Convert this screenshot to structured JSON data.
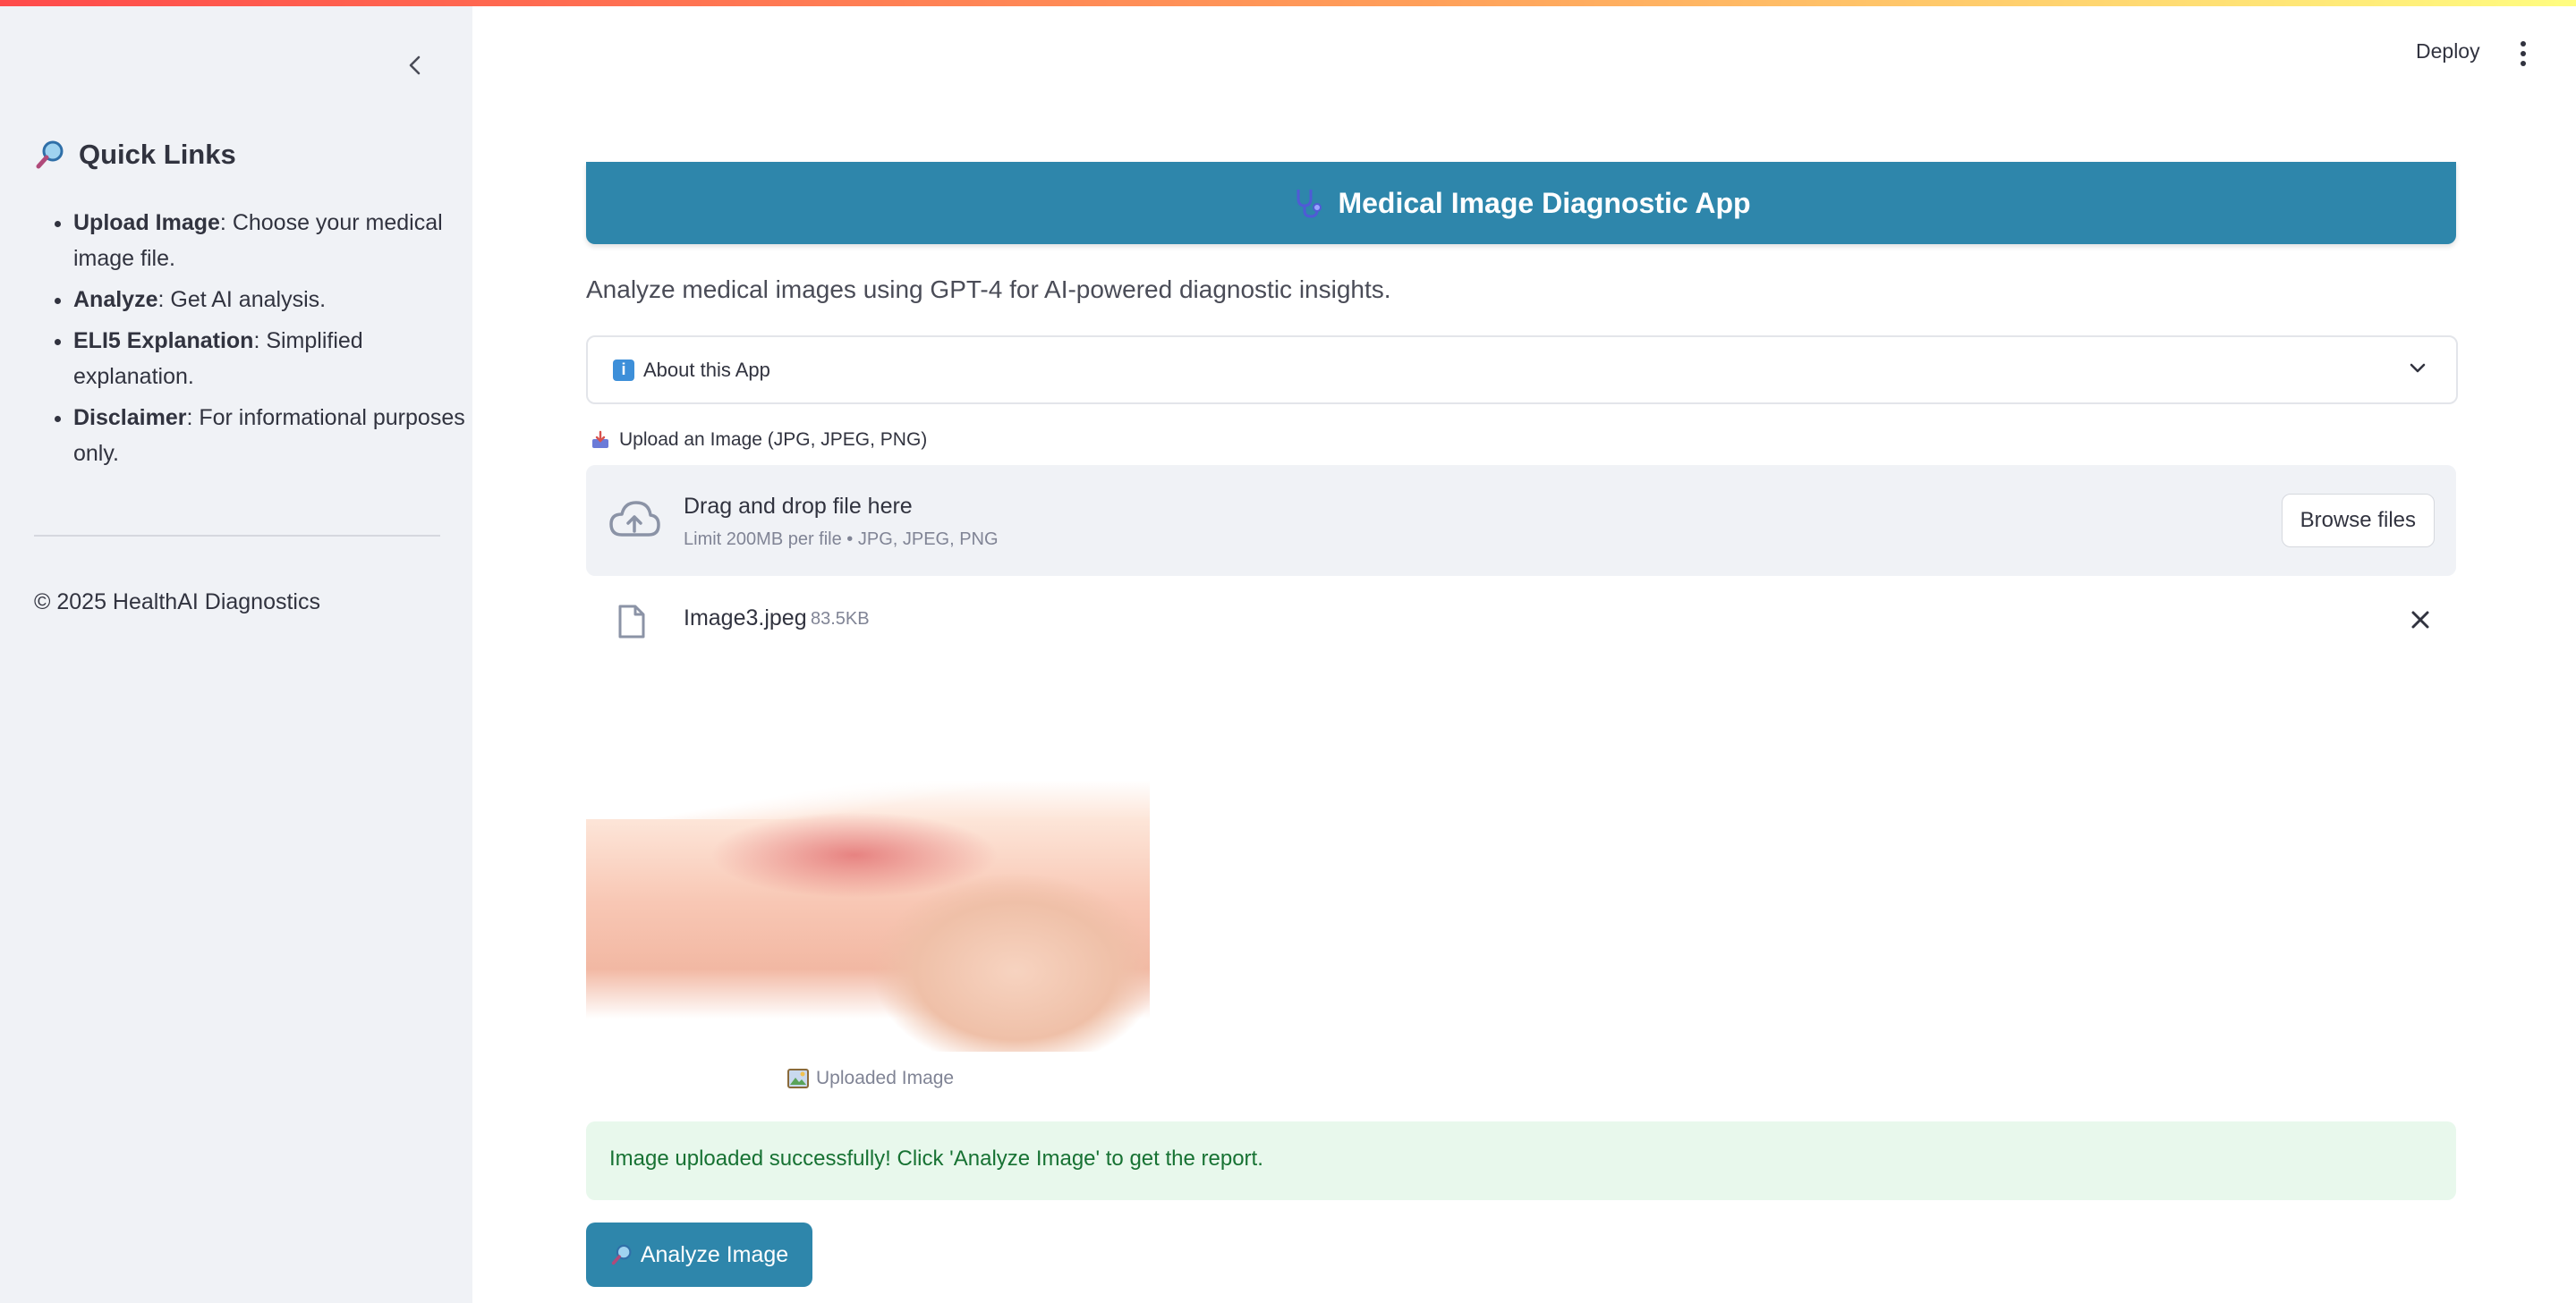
{
  "sidebar": {
    "heading": "Quick Links",
    "items": [
      {
        "term": "Upload Image",
        "desc": ": Choose your medical image file."
      },
      {
        "term": "Analyze",
        "desc": ": Get AI analysis."
      },
      {
        "term": "ELI5 Explanation",
        "desc": ": Simplified explanation."
      },
      {
        "term": "Disclaimer",
        "desc": ": For informational purposes only."
      }
    ],
    "footer": "© 2025 HealthAI Diagnostics"
  },
  "header": {
    "deploy_label": "Deploy"
  },
  "main": {
    "title": "Medical Image Diagnostic App",
    "subtitle": "Analyze medical images using GPT-4 for AI-powered diagnostic insights.",
    "expander_label": "About this App",
    "uploader": {
      "label": "Upload an Image (JPG, JPEG, PNG)",
      "drop_text": "Drag and drop file here",
      "limit_text": "Limit 200MB per file • JPG, JPEG, PNG",
      "browse_label": "Browse files"
    },
    "file": {
      "name": "Image3.jpeg",
      "size": "83.5KB"
    },
    "image_caption": "Uploaded Image",
    "success_message": "Image uploaded successfully! Click 'Analyze Image' to get the report.",
    "analyze_label": "Analyze Image"
  },
  "colors": {
    "accent": "#2e86ab",
    "sidebar_bg": "#f0f2f6",
    "success_bg": "#e8f8ec",
    "success_text": "#177233"
  },
  "icons": {
    "collapse": "chevron-left-icon",
    "quick_links": "magnifier-icon",
    "title": "stethoscope-icon",
    "expander_info": "info-icon",
    "expander_toggle": "chevron-down-icon",
    "upload": "inbox-tray-icon",
    "cloud": "cloud-upload-icon",
    "file": "file-icon",
    "remove": "close-icon",
    "caption": "picture-icon",
    "analyze": "magnifier-icon"
  }
}
